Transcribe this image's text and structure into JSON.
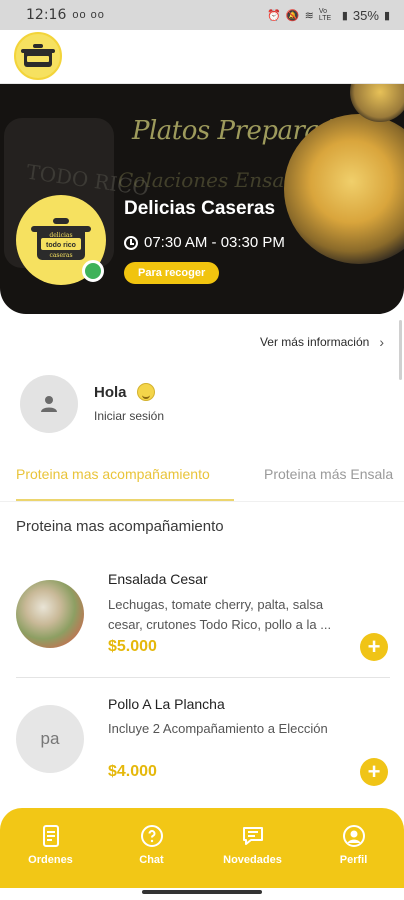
{
  "status_bar": {
    "time": "12:16",
    "left_icons": "oo oo",
    "network": "Vo LTE",
    "battery": "35%"
  },
  "banner": {
    "bg_text_1": "Platos Preparados",
    "bg_text_2": "Colaciones Ensaladas",
    "bg_text_3": "TODO RICO",
    "logo_text_top": "delicias",
    "logo_text_mid": "todo rico",
    "logo_text_bottom": "caseras",
    "store_name": "Delicias Caseras",
    "hours": "07:30 AM - 03:30 PM",
    "pickup_label": "Para recoger"
  },
  "more_info": "Ver más información",
  "greeting": {
    "title": "Hola",
    "login_link": "Iniciar sesión"
  },
  "tabs": [
    {
      "label": "Proteina mas acompañamiento",
      "active": true
    },
    {
      "label": "Proteina más Ensala",
      "active": false
    }
  ],
  "section_title": "Proteina mas acompañamiento",
  "products": [
    {
      "name": "Ensalada Cesar",
      "description": "Lechugas, tomate cherry, palta, salsa cesar, crutones Todo Rico, pollo a la ...",
      "price": "$5.000"
    },
    {
      "name": "Pollo A La Plancha",
      "description": "Incluye 2 Acompañamiento a Elección",
      "price": "$4.000",
      "placeholder": "pa"
    }
  ],
  "add_symbol": "+",
  "bottom_nav": [
    {
      "label": "Ordenes",
      "icon": "orders-icon"
    },
    {
      "label": "Chat",
      "icon": "chat-icon"
    },
    {
      "label": "Novedades",
      "icon": "news-icon"
    },
    {
      "label": "Perfil",
      "icon": "profile-icon"
    }
  ],
  "colors": {
    "accent": "#f2c716",
    "price": "#e5b80b",
    "banner_bg": "#151311",
    "online": "#3fb25a"
  }
}
